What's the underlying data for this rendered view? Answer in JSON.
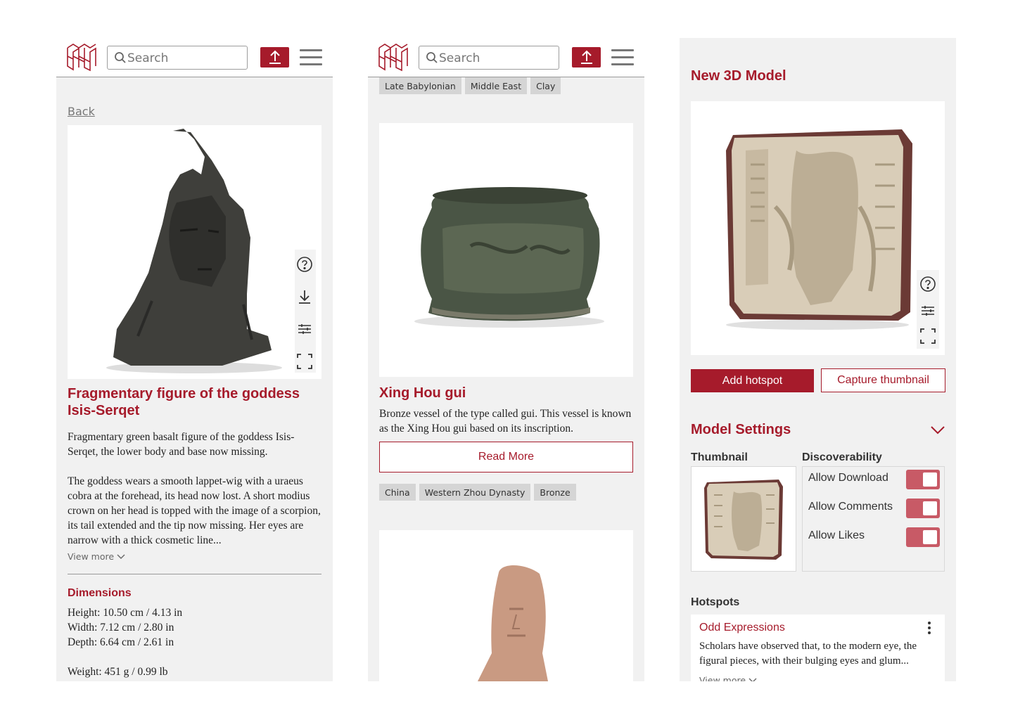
{
  "header": {
    "search_placeholder": "Search"
  },
  "detail": {
    "back_label": "Back",
    "title": "Fragmentary figure of the goddess Isis-Serqet",
    "para1": "Fragmentary green basalt figure of the goddess Isis-Serqet, the lower body and base now missing.",
    "para2": "The goddess wears a smooth lappet-wig with a uraeus cobra at the forehead, its head now lost. A short modius crown on her head is topped with the image of a scorpion, its tail extended and the tip now missing. Her eyes are narrow with a thick cosmetic line...",
    "view_more": "View more",
    "dimensions_title": "Dimensions",
    "height": "Height: 10.50 cm / 4.13 in",
    "width": "Width: 7.12 cm / 2.80 in",
    "depth": "Depth: 6.64 cm / 2.61 in",
    "weight": "Weight: 451 g / 0.99 lb"
  },
  "feed": {
    "top_tags": [
      "Late Babylonian",
      "Middle East",
      "Clay"
    ],
    "item_title": "Xing Hou gui",
    "item_desc": "Bronze vessel of the type called gui. This vessel is known as the Xing Hou gui based on its inscription.",
    "read_more": "Read More",
    "item_tags": [
      "China",
      "Western Zhou Dynasty",
      "Bronze"
    ]
  },
  "editor": {
    "title": "New 3D Model",
    "add_hotspot": "Add hotspot",
    "capture_thumbnail": "Capture thumbnail",
    "settings_title": "Model Settings",
    "thumbnail_label": "Thumbnail",
    "discoverability_label": "Discoverability",
    "toggles": [
      {
        "label": "Allow Download",
        "on": true
      },
      {
        "label": "Allow Comments",
        "on": true
      },
      {
        "label": "Allow Likes",
        "on": true
      }
    ],
    "hotspots_label": "Hotspots",
    "hotspot": {
      "title": "Odd Expressions",
      "text": "Scholars have observed that, to the modern eye, the figural pieces, with their bulging eyes and glum...",
      "view_more": "View more"
    }
  },
  "colors": {
    "accent": "#a61b2b",
    "toggle": "#c85a66",
    "panel_bg": "#f1f1f1",
    "tag_bg": "#d5d5d5"
  },
  "icons": [
    "logo-icon",
    "search-icon",
    "upload-icon",
    "menu-icon",
    "help-icon",
    "download-icon",
    "sliders-icon",
    "fullscreen-icon",
    "chevron-down-icon",
    "more-vertical-icon"
  ]
}
